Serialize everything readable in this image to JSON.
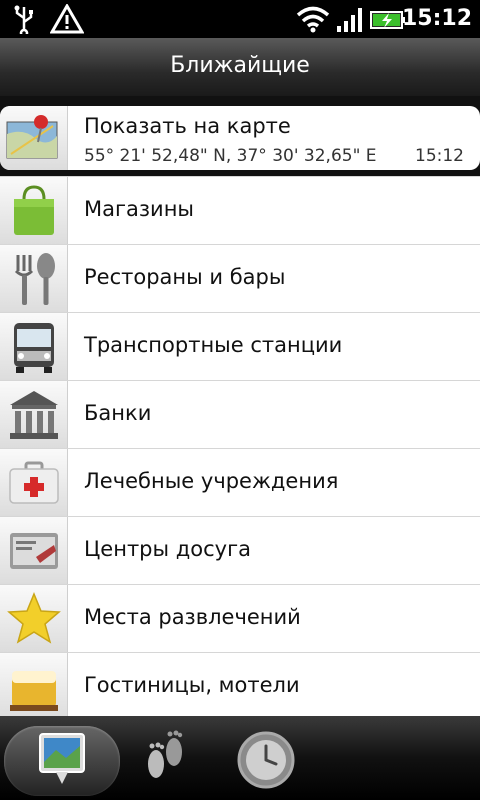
{
  "status": {
    "time": "15:12",
    "icons": [
      "usb-icon",
      "warning-icon",
      "wifi-icon",
      "signal-icon",
      "battery-charging-icon"
    ]
  },
  "header": {
    "title": "Ближайщие"
  },
  "map_item": {
    "label": "Показать на карте",
    "coords": "55° 21' 52,48\" N, 37° 30' 32,65\" E",
    "time": "15:12",
    "icon": "map-pin-icon"
  },
  "categories": [
    {
      "label": "Магазины",
      "icon": "shopping-bag-icon"
    },
    {
      "label": "Рестораны и бары",
      "icon": "fork-spoon-icon"
    },
    {
      "label": "Транспортные станции",
      "icon": "bus-icon"
    },
    {
      "label": "Банки",
      "icon": "bank-icon"
    },
    {
      "label": "Лечебные учреждения",
      "icon": "first-aid-kit-icon"
    },
    {
      "label": "Центры досуга",
      "icon": "tickets-icon"
    },
    {
      "label": "Места развлечений",
      "icon": "star-icon"
    },
    {
      "label": "Гостиницы, мотели",
      "icon": "bed-icon"
    }
  ],
  "tabs": [
    {
      "name": "nearby-tab",
      "icon": "photo-pin-icon",
      "active": true
    },
    {
      "name": "footprints-tab",
      "icon": "footprints-icon",
      "active": false
    },
    {
      "name": "history-tab",
      "icon": "clock-icon",
      "active": false
    }
  ]
}
